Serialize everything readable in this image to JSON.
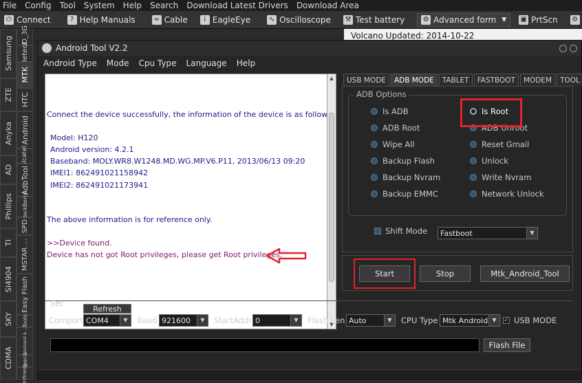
{
  "menubar": [
    "File",
    "Config",
    "Tool",
    "System",
    "Help",
    "Search",
    "Download Latest Drivers",
    "Download Area"
  ],
  "toolbar": {
    "connect": "Connect",
    "help_manuals": "Help Manuals",
    "cable": "Cable",
    "eagleeye": "EagleEye",
    "oscilloscope": "Oscilloscope",
    "test_battery": "Test battery",
    "advanced_form": "Advanced form",
    "prtscn": "PrtScn"
  },
  "left_tabs": {
    "col1": [
      "Samsung",
      "ZTE",
      "Anyka",
      "AD",
      "Phillips",
      "TI",
      "SI4904",
      "SKY",
      "CDMA"
    ],
    "col2": [
      "AD_3G",
      "Detect",
      "MTK",
      "HTC",
      "Android",
      "Alcatel",
      "AdbTool",
      "BlackBerry",
      "SPD",
      "MSTAR ...",
      "Easy Flash",
      "Tools",
      "Coolsand & ...",
      "Xperia",
      "Infineon"
    ]
  },
  "background_doc": "Volcano Updated: 2014-10-22",
  "window": {
    "title": "Android Tool V2.2",
    "menu": [
      "Android Type",
      "Mode",
      "Cpu Type",
      "Language",
      "Help"
    ]
  },
  "log": {
    "connected": "Connect the device successfully, the information of the device is as follows:",
    "model": "Model: H120",
    "android_version": "Android version: 4.2.1",
    "baseband": "Baseband: MOLY.WR8.W1248.MD.WG.MP.V6.P11, 2013/06/13 09:20",
    "imei1": "IMEI1:  862491021158942",
    "imei2": "IMEI2:  862491021173941",
    "reference": "The above information is for reference only.",
    "device_found": ">>Device found.",
    "no_root": "Device has not got Root privileges, please get Root privileges."
  },
  "tabs": [
    "USB MODE",
    "ADB MODE",
    "TABLET",
    "FASTBOOT",
    "MODEM",
    "TOOL"
  ],
  "adb_options": {
    "label": "ADB Options",
    "left": [
      "Is ADB",
      "ADB Root",
      "Wipe All",
      "Backup Flash",
      "Backup Nvram",
      "Backup EMMC"
    ],
    "right": [
      "Is Root",
      "ADB Unroot",
      "Reset Gmail",
      "Unlock",
      "Write Nvram",
      "Network Unlock"
    ]
  },
  "shift_mode": {
    "label": "Shift Mode",
    "value": "Fastboot"
  },
  "buttons": {
    "start": "Start",
    "stop": "Stop",
    "mtk_android_tool": "Mtk_Android_Tool"
  },
  "set": {
    "label": "Set",
    "refresh": "Refresh",
    "comport_label": "Comport",
    "comport_value": "COM4",
    "baud_label": "Baud",
    "baud_value": "921600",
    "startaddr_label": "StartAddr",
    "startaddr_value": "0",
    "flashlen_label": "Flash Len",
    "flashlen_value": "Auto",
    "cputype_label": "CPU Type",
    "cputype_value": "Mtk Android",
    "usbmode_label": "USB MODE",
    "flash_file": "Flash File"
  },
  "colors": {
    "highlight_red": "#e3242b",
    "log_navy": "#1a1a8a",
    "log_purple": "#7a1a6a"
  }
}
